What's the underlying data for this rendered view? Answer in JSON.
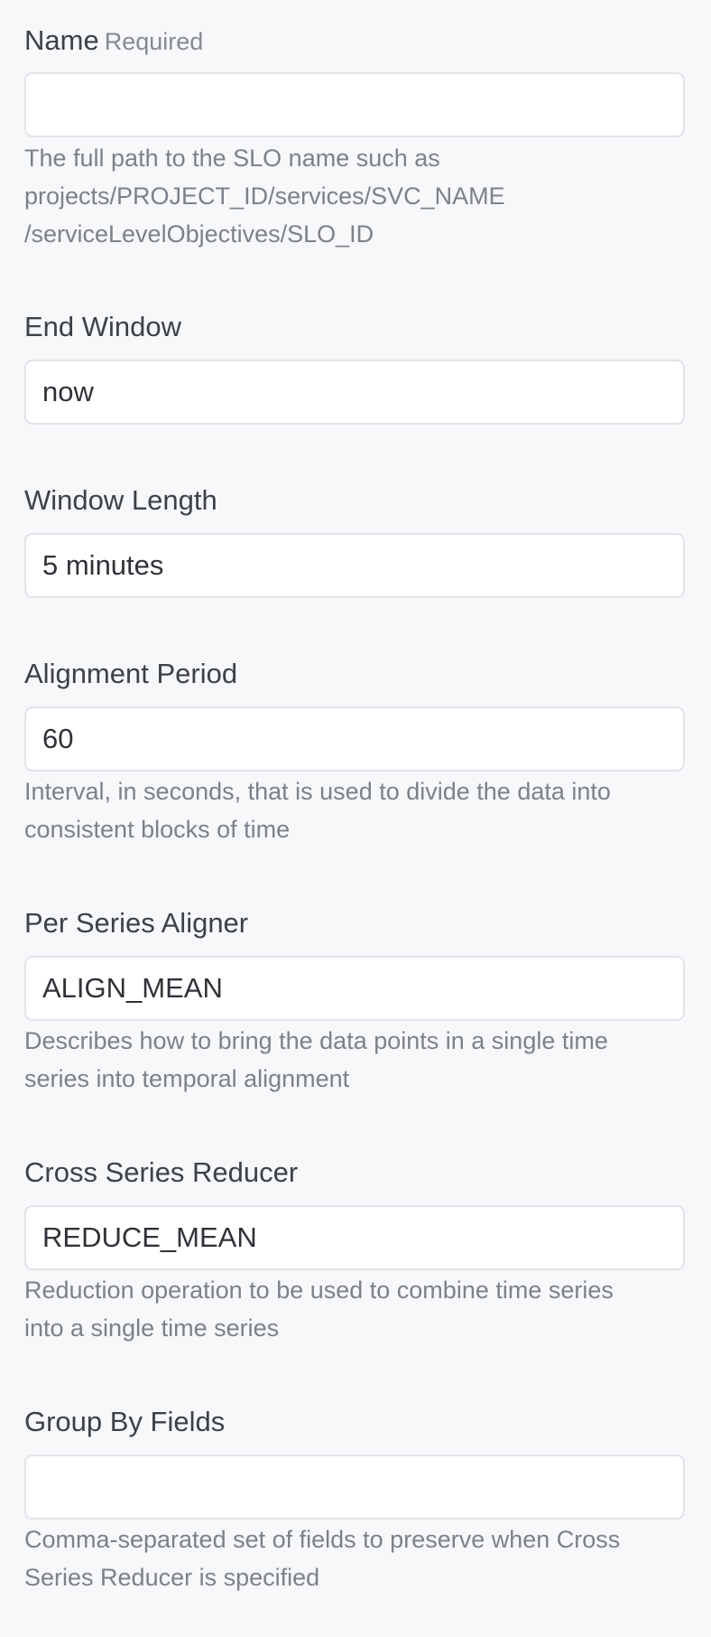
{
  "fields": {
    "name": {
      "label": "Name",
      "required": "Required",
      "value": "",
      "help_lines": [
        "The full path to the SLO name such as",
        "projects/PROJECT_ID/services/SVC_NAME",
        "/serviceLevelObjectives/SLO_ID"
      ]
    },
    "end_window": {
      "label": "End Window",
      "value": "now"
    },
    "window_length": {
      "label": "Window Length",
      "value": "5 minutes"
    },
    "alignment_period": {
      "label": "Alignment Period",
      "value": "60",
      "help_lines": [
        "Interval, in seconds, that is used to divide the data into",
        "consistent blocks of time"
      ]
    },
    "per_series_aligner": {
      "label": "Per Series Aligner",
      "value": "ALIGN_MEAN",
      "help_lines": [
        "Describes how to bring the data points in a single time",
        "series into temporal alignment"
      ]
    },
    "cross_series_reducer": {
      "label": "Cross Series Reducer",
      "value": "REDUCE_MEAN",
      "help_lines": [
        "Reduction operation to be used to combine time series",
        "into a single time series"
      ]
    },
    "group_by_fields": {
      "label": "Group By Fields",
      "value": "",
      "help_lines": [
        "Comma-separated set of fields to preserve when Cross",
        "Series Reducer is specified"
      ]
    }
  }
}
